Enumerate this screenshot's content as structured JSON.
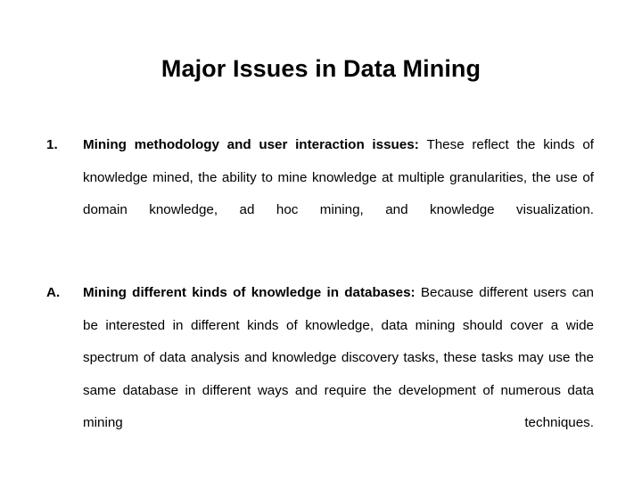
{
  "slide": {
    "title": "Major Issues in Data Mining",
    "background_color": "#ffffff",
    "text_color": "#000000",
    "items": [
      {
        "marker": "1.",
        "lead_in": "Mining methodology and user interaction issues",
        "separator": ": ",
        "body": "These reflect the kinds of knowledge mined, the ability to mine knowledge at multiple granularities, the use of domain knowledge, ad hoc mining, and knowledge visualization."
      },
      {
        "marker": "A.",
        "lead_in": "Mining different kinds of knowledge in databases",
        "separator": ": ",
        "body": "Because different users can be interested in different kinds of knowledge, data mining should cover a wide spectrum of data analysis and knowledge discovery tasks, these tasks may use the same database in different ways and require the development of numerous data mining techniques."
      }
    ]
  }
}
